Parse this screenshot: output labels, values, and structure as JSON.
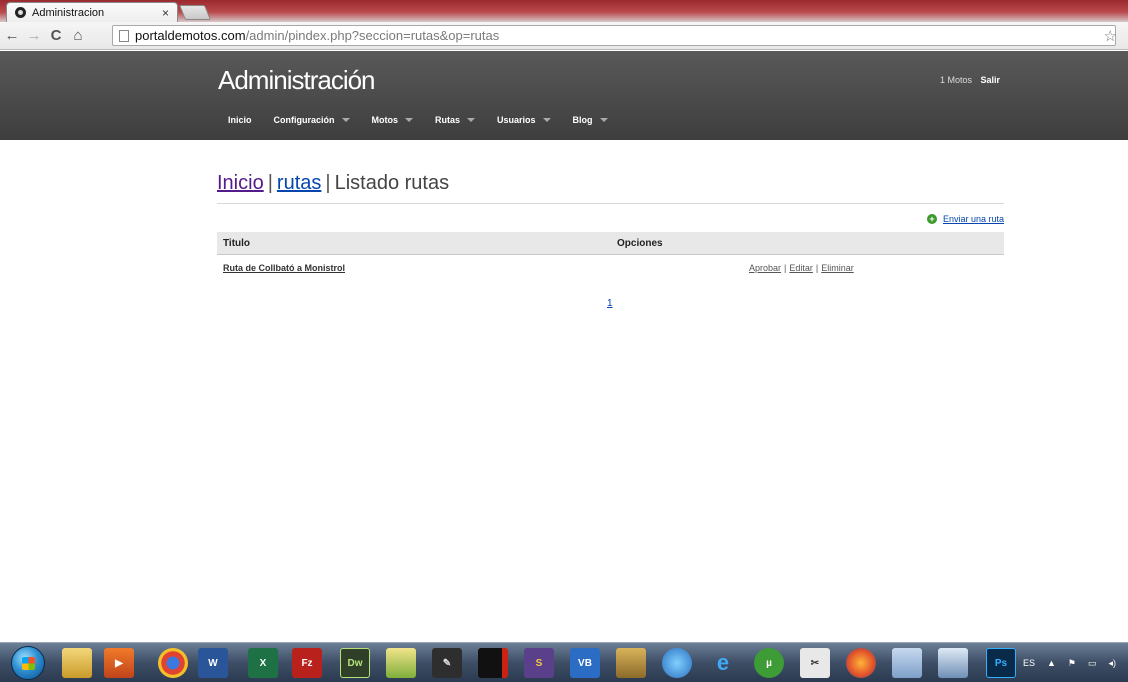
{
  "browser": {
    "tab_title": "Administracion",
    "tab_close": "×",
    "back_glyph": "←",
    "forward_glyph": "→",
    "reload_glyph": "C",
    "home_glyph": "⌂",
    "url_host": "portaldemotos.com",
    "url_path": "/admin/pindex.php?seccion=rutas&op=rutas",
    "bookmark_glyph": "☆"
  },
  "header": {
    "brand": "Administración",
    "user_count": "1 Motos",
    "logout": "Salir",
    "nav": [
      {
        "label": "Inicio",
        "dropdown": false
      },
      {
        "label": "Configuración",
        "dropdown": true
      },
      {
        "label": "Motos",
        "dropdown": true
      },
      {
        "label": "Rutas",
        "dropdown": true
      },
      {
        "label": "Usuarios",
        "dropdown": true
      },
      {
        "label": "Blog",
        "dropdown": true
      }
    ]
  },
  "breadcrumb": {
    "home": "Inicio",
    "section": "rutas",
    "current": "Listado rutas",
    "separator": "|"
  },
  "actions": {
    "send_route": "Enviar una ruta"
  },
  "table": {
    "col_title": "Titulo",
    "col_options": "Opciones",
    "rows": [
      {
        "title": "Ruta de Collbató a Monistrol",
        "approve": "Aprobar",
        "edit": "Editar",
        "delete": "Eliminar",
        "sep": "|"
      }
    ]
  },
  "pagination": {
    "pages": [
      "1"
    ]
  },
  "taskbar": {
    "language": "ES",
    "icons": [
      "explorer-icon",
      "media-player-icon",
      "chrome-icon",
      "word-icon",
      "excel-icon",
      "filezilla-icon",
      "dreamweaver-icon",
      "notepad-icon",
      "inkscape-icon",
      "terminal-icon",
      "sublime-icon",
      "virtualbox-icon",
      "brush-icon",
      "network-icon",
      "internet-explorer-icon",
      "utorrent-icon",
      "snipping-icon",
      "firefox-icon",
      "paint-icon",
      "window-icon",
      "photoshop-icon"
    ],
    "colors": {
      "bar": "#3d4e66",
      "accent": "#2d8fd0"
    }
  }
}
